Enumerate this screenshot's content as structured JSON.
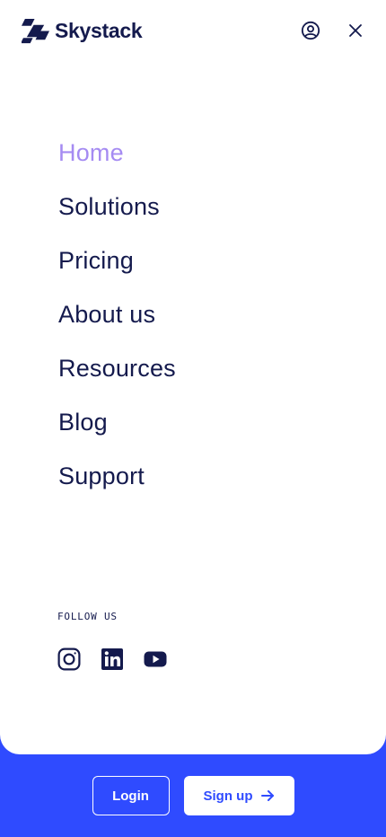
{
  "brand": {
    "name": "Skystack",
    "logo_icon": "skystack-logo-icon"
  },
  "header": {
    "account_icon": "user-circle-icon",
    "close_icon": "close-icon"
  },
  "nav": {
    "items": [
      {
        "label": "Home",
        "active": true
      },
      {
        "label": "Solutions",
        "active": false
      },
      {
        "label": "Pricing",
        "active": false
      },
      {
        "label": "About us",
        "active": false
      },
      {
        "label": "Resources",
        "active": false
      },
      {
        "label": "Blog",
        "active": false
      },
      {
        "label": "Support",
        "active": false
      }
    ]
  },
  "follow": {
    "label": "FOLLOW US",
    "socials": [
      {
        "icon": "instagram-icon"
      },
      {
        "icon": "linkedin-icon"
      },
      {
        "icon": "youtube-icon"
      }
    ]
  },
  "footer": {
    "login_label": "Login",
    "signup_label": "Sign up",
    "signup_icon": "arrow-right-icon"
  },
  "colors": {
    "accent": "#2f4bff",
    "text": "#141a4d",
    "active_nav": "#a58bf2",
    "panel": "#ffffff"
  }
}
